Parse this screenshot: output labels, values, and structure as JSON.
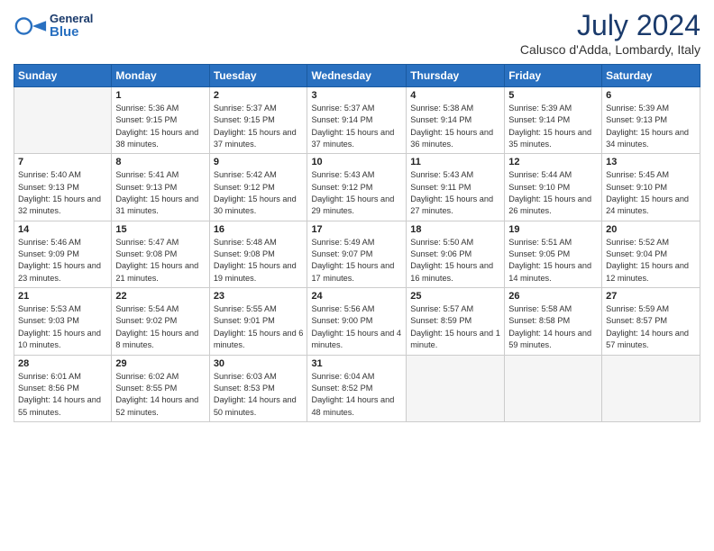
{
  "header": {
    "logo_general": "General",
    "logo_blue": "Blue",
    "month_title": "July 2024",
    "location": "Calusco d'Adda, Lombardy, Italy"
  },
  "weekdays": [
    "Sunday",
    "Monday",
    "Tuesday",
    "Wednesday",
    "Thursday",
    "Friday",
    "Saturday"
  ],
  "weeks": [
    [
      {
        "day": "",
        "info": ""
      },
      {
        "day": "1",
        "info": "Sunrise: 5:36 AM\nSunset: 9:15 PM\nDaylight: 15 hours\nand 38 minutes."
      },
      {
        "day": "2",
        "info": "Sunrise: 5:37 AM\nSunset: 9:15 PM\nDaylight: 15 hours\nand 37 minutes."
      },
      {
        "day": "3",
        "info": "Sunrise: 5:37 AM\nSunset: 9:14 PM\nDaylight: 15 hours\nand 37 minutes."
      },
      {
        "day": "4",
        "info": "Sunrise: 5:38 AM\nSunset: 9:14 PM\nDaylight: 15 hours\nand 36 minutes."
      },
      {
        "day": "5",
        "info": "Sunrise: 5:39 AM\nSunset: 9:14 PM\nDaylight: 15 hours\nand 35 minutes."
      },
      {
        "day": "6",
        "info": "Sunrise: 5:39 AM\nSunset: 9:13 PM\nDaylight: 15 hours\nand 34 minutes."
      }
    ],
    [
      {
        "day": "7",
        "info": "Sunrise: 5:40 AM\nSunset: 9:13 PM\nDaylight: 15 hours\nand 32 minutes."
      },
      {
        "day": "8",
        "info": "Sunrise: 5:41 AM\nSunset: 9:13 PM\nDaylight: 15 hours\nand 31 minutes."
      },
      {
        "day": "9",
        "info": "Sunrise: 5:42 AM\nSunset: 9:12 PM\nDaylight: 15 hours\nand 30 minutes."
      },
      {
        "day": "10",
        "info": "Sunrise: 5:43 AM\nSunset: 9:12 PM\nDaylight: 15 hours\nand 29 minutes."
      },
      {
        "day": "11",
        "info": "Sunrise: 5:43 AM\nSunset: 9:11 PM\nDaylight: 15 hours\nand 27 minutes."
      },
      {
        "day": "12",
        "info": "Sunrise: 5:44 AM\nSunset: 9:10 PM\nDaylight: 15 hours\nand 26 minutes."
      },
      {
        "day": "13",
        "info": "Sunrise: 5:45 AM\nSunset: 9:10 PM\nDaylight: 15 hours\nand 24 minutes."
      }
    ],
    [
      {
        "day": "14",
        "info": "Sunrise: 5:46 AM\nSunset: 9:09 PM\nDaylight: 15 hours\nand 23 minutes."
      },
      {
        "day": "15",
        "info": "Sunrise: 5:47 AM\nSunset: 9:08 PM\nDaylight: 15 hours\nand 21 minutes."
      },
      {
        "day": "16",
        "info": "Sunrise: 5:48 AM\nSunset: 9:08 PM\nDaylight: 15 hours\nand 19 minutes."
      },
      {
        "day": "17",
        "info": "Sunrise: 5:49 AM\nSunset: 9:07 PM\nDaylight: 15 hours\nand 17 minutes."
      },
      {
        "day": "18",
        "info": "Sunrise: 5:50 AM\nSunset: 9:06 PM\nDaylight: 15 hours\nand 16 minutes."
      },
      {
        "day": "19",
        "info": "Sunrise: 5:51 AM\nSunset: 9:05 PM\nDaylight: 15 hours\nand 14 minutes."
      },
      {
        "day": "20",
        "info": "Sunrise: 5:52 AM\nSunset: 9:04 PM\nDaylight: 15 hours\nand 12 minutes."
      }
    ],
    [
      {
        "day": "21",
        "info": "Sunrise: 5:53 AM\nSunset: 9:03 PM\nDaylight: 15 hours\nand 10 minutes."
      },
      {
        "day": "22",
        "info": "Sunrise: 5:54 AM\nSunset: 9:02 PM\nDaylight: 15 hours\nand 8 minutes."
      },
      {
        "day": "23",
        "info": "Sunrise: 5:55 AM\nSunset: 9:01 PM\nDaylight: 15 hours\nand 6 minutes."
      },
      {
        "day": "24",
        "info": "Sunrise: 5:56 AM\nSunset: 9:00 PM\nDaylight: 15 hours\nand 4 minutes."
      },
      {
        "day": "25",
        "info": "Sunrise: 5:57 AM\nSunset: 8:59 PM\nDaylight: 15 hours\nand 1 minute."
      },
      {
        "day": "26",
        "info": "Sunrise: 5:58 AM\nSunset: 8:58 PM\nDaylight: 14 hours\nand 59 minutes."
      },
      {
        "day": "27",
        "info": "Sunrise: 5:59 AM\nSunset: 8:57 PM\nDaylight: 14 hours\nand 57 minutes."
      }
    ],
    [
      {
        "day": "28",
        "info": "Sunrise: 6:01 AM\nSunset: 8:56 PM\nDaylight: 14 hours\nand 55 minutes."
      },
      {
        "day": "29",
        "info": "Sunrise: 6:02 AM\nSunset: 8:55 PM\nDaylight: 14 hours\nand 52 minutes."
      },
      {
        "day": "30",
        "info": "Sunrise: 6:03 AM\nSunset: 8:53 PM\nDaylight: 14 hours\nand 50 minutes."
      },
      {
        "day": "31",
        "info": "Sunrise: 6:04 AM\nSunset: 8:52 PM\nDaylight: 14 hours\nand 48 minutes."
      },
      {
        "day": "",
        "info": ""
      },
      {
        "day": "",
        "info": ""
      },
      {
        "day": "",
        "info": ""
      }
    ]
  ]
}
